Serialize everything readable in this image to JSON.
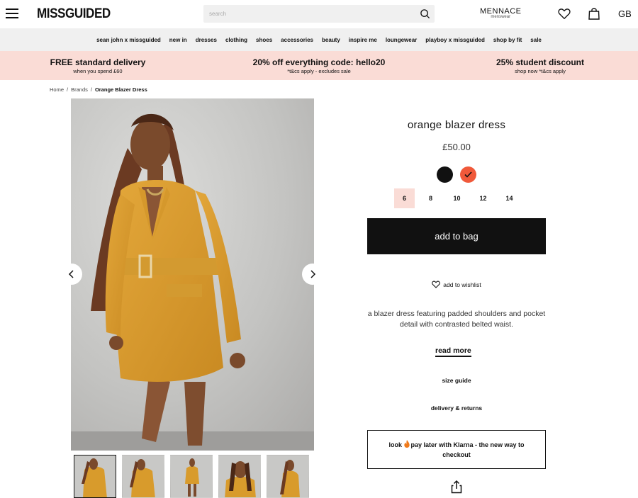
{
  "header": {
    "logo": "MISSGUIDED",
    "search_placeholder": "search",
    "mennace_title": "MENNACE",
    "mennace_sub": "menswear",
    "region": "GB"
  },
  "nav": {
    "items": [
      "sean john x missguided",
      "new in",
      "dresses",
      "clothing",
      "shoes",
      "accessories",
      "beauty",
      "inspire me",
      "loungewear",
      "playboy x missguided",
      "shop by fit",
      "sale"
    ]
  },
  "promo": {
    "delivery_title": "FREE standard delivery",
    "delivery_sub": "when you spend £60",
    "discount_title": "20% off everything code: hello20",
    "discount_sub": "*t&cs apply - excludes sale",
    "student_title": "25% student discount",
    "student_sub": "shop now *t&cs apply"
  },
  "breadcrumb": {
    "home": "Home",
    "brands": "Brands",
    "current": "Orange Blazer Dress"
  },
  "product": {
    "title": "orange blazer dress",
    "price": "£50.00",
    "colors": [
      "#111111",
      "#f0593a"
    ],
    "selected_color": "#f0593a",
    "sizes": [
      "6",
      "8",
      "10",
      "12",
      "14"
    ],
    "selected_size": "6",
    "add_to_bag": "add to bag",
    "wishlist": "add to wishlist",
    "description": "a blazer dress featuring padded shoulders and pocket detail with contrasted belted waist.",
    "read_more": "read more",
    "size_guide": "size guide",
    "delivery_returns": "delivery & returns",
    "klarna_prefix": "look ",
    "klarna_rest": "pay later with Klarna - the new way to checkout",
    "thumbnails": 5
  }
}
